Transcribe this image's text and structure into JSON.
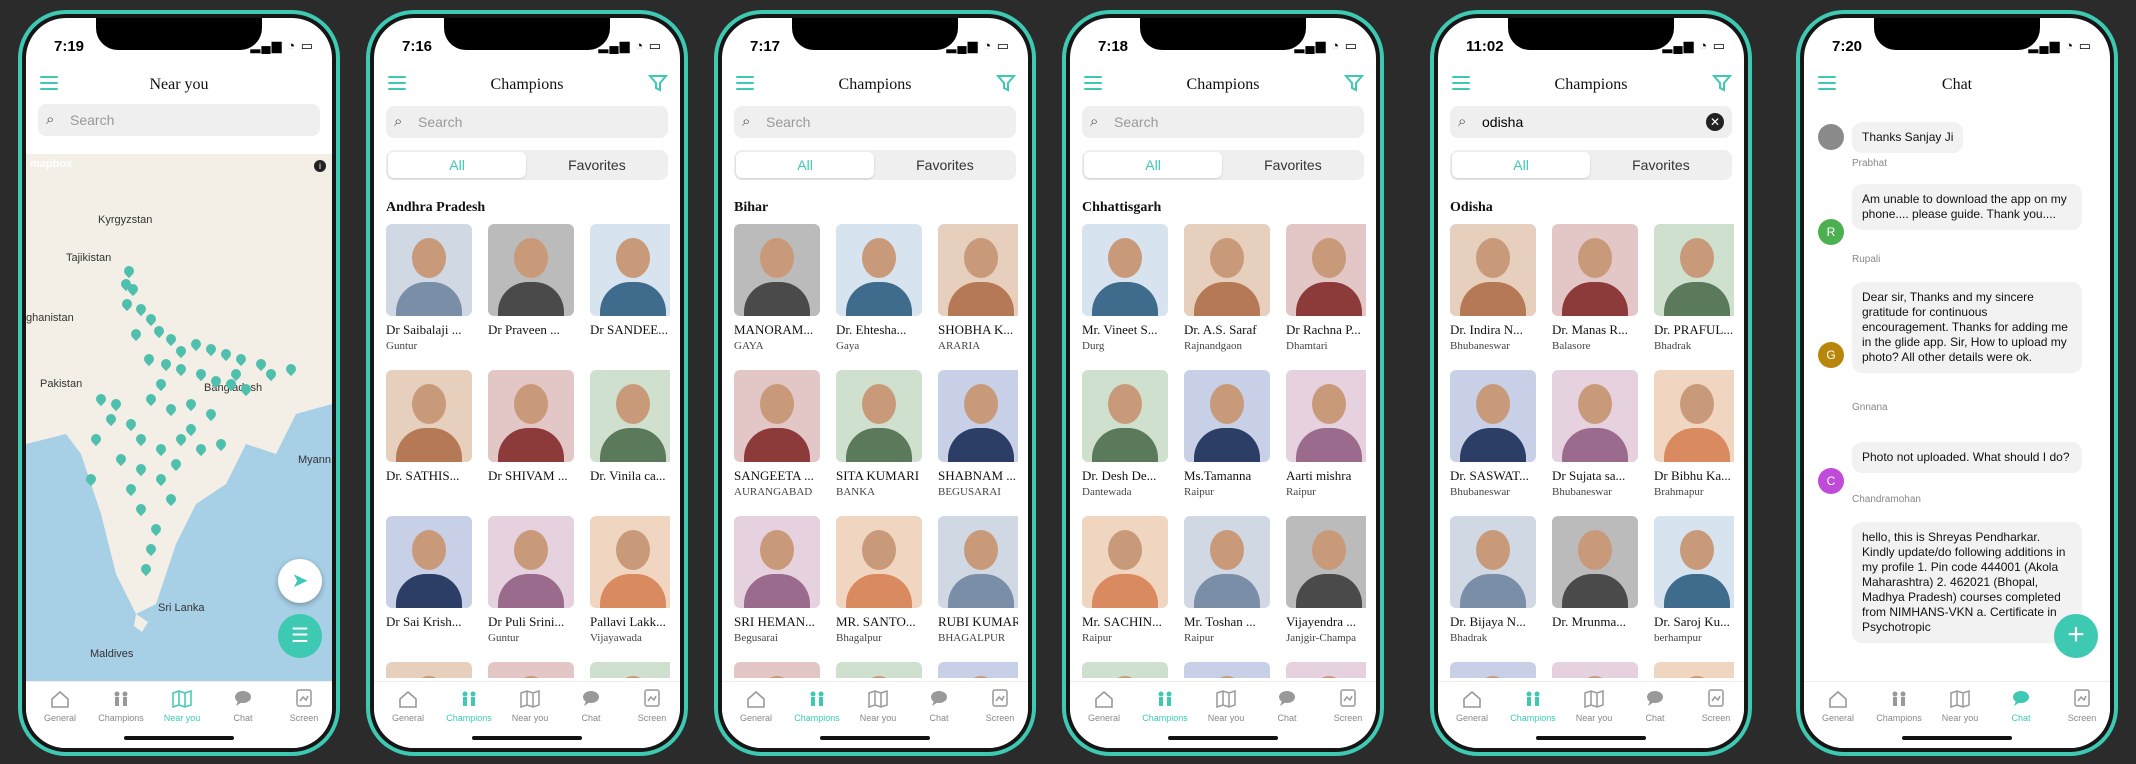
{
  "colors": {
    "accent": "#3ec9b3",
    "frame": "#161616",
    "map_water": "#a7cfe6",
    "map_land": "#f3efe6"
  },
  "tabs": [
    "General",
    "Champions",
    "Near you",
    "Chat",
    "Screen"
  ],
  "screens": [
    {
      "id": "near",
      "time": "7:19",
      "title": "Near you",
      "search_placeholder": "Search",
      "map": {
        "brand": "mapbox",
        "labels": [
          "Kyrgyzstan",
          "Tajikistan",
          "ghanistan",
          "Pakistan",
          "Nepal",
          "Bangladesh",
          "Myann (Burn",
          "Sri Lanka",
          "Maldives"
        ]
      },
      "active_tab": "Near you"
    },
    {
      "id": "ap",
      "time": "7:16",
      "title": "Champions",
      "search_placeholder": "Search",
      "seg": [
        "All",
        "Favorites"
      ],
      "section": "Andhra Pradesh",
      "cards": [
        {
          "name": "Dr Saibalaji ...",
          "city": "Guntur"
        },
        {
          "name": "Dr Praveen ...",
          "city": ""
        },
        {
          "name": "Dr SANDEE...",
          "city": ""
        },
        {
          "name": "Dr. SATHIS...",
          "city": ""
        },
        {
          "name": "Dr SHIVAM ...",
          "city": ""
        },
        {
          "name": "Dr. Vinila ca...",
          "city": ""
        },
        {
          "name": "Dr Sai Krish...",
          "city": ""
        },
        {
          "name": "Dr Puli Srini...",
          "city": "Guntur"
        },
        {
          "name": "Pallavi Lakk...",
          "city": "Vijayawada"
        }
      ],
      "active_tab": "Champions"
    },
    {
      "id": "bihar",
      "time": "7:17",
      "title": "Champions",
      "search_placeholder": "Search",
      "seg": [
        "All",
        "Favorites"
      ],
      "section": "Bihar",
      "cards": [
        {
          "name": "MANORAM...",
          "city": "GAYA"
        },
        {
          "name": "Dr. Ehtesha...",
          "city": "Gaya"
        },
        {
          "name": "SHOBHA K...",
          "city": "ARARIA"
        },
        {
          "name": "SANGEETA ...",
          "city": "AURANGABAD"
        },
        {
          "name": "SITA KUMARI",
          "city": "BANKA"
        },
        {
          "name": "SHABNAM ...",
          "city": "BEGUSARAI"
        },
        {
          "name": "SRI HEMAN...",
          "city": "Begusarai"
        },
        {
          "name": "MR. SANTO...",
          "city": "Bhagalpur"
        },
        {
          "name": "RUBI KUMARI",
          "city": "BHAGALPUR"
        }
      ],
      "active_tab": "Champions"
    },
    {
      "id": "chh",
      "time": "7:18",
      "title": "Champions",
      "search_placeholder": "Search",
      "seg": [
        "All",
        "Favorites"
      ],
      "section": "Chhattisgarh",
      "cards": [
        {
          "name": "Mr. Vineet S...",
          "city": "Durg"
        },
        {
          "name": "Dr. A.S. Saraf",
          "city": "Rajnandgaon"
        },
        {
          "name": "Dr Rachna P...",
          "city": "Dhamtari"
        },
        {
          "name": "Dr. Desh De...",
          "city": "Dantewada"
        },
        {
          "name": "Ms.Tamanna",
          "city": "Raipur"
        },
        {
          "name": "Aarti mishra",
          "city": "Raipur"
        },
        {
          "name": "Mr. SACHIN...",
          "city": "Raipur"
        },
        {
          "name": "Mr. Toshan ...",
          "city": "Raipur"
        },
        {
          "name": "Vijayendra ...",
          "city": "Janjgir-Champa"
        }
      ],
      "active_tab": "Champions"
    },
    {
      "id": "odisha",
      "time": "11:02",
      "title": "Champions",
      "search_value": "odisha",
      "seg": [
        "All",
        "Favorites"
      ],
      "section": "Odisha",
      "cards": [
        {
          "name": "Dr. Indira N...",
          "city": "Bhubaneswar"
        },
        {
          "name": "Dr. Manas R...",
          "city": "Balasore"
        },
        {
          "name": "Dr. PRAFUL...",
          "city": "Bhadrak"
        },
        {
          "name": "Dr. SASWAT...",
          "city": "Bhubaneswar"
        },
        {
          "name": "Dr Sujata sa...",
          "city": "Bhubaneswar"
        },
        {
          "name": "Dr Bibhu Ka...",
          "city": "Brahmapur"
        },
        {
          "name": "Dr. Bijaya N...",
          "city": "Bhadrak"
        },
        {
          "name": "Dr. Mrunma...",
          "city": ""
        },
        {
          "name": "Dr. Saroj Ku...",
          "city": "berhampur"
        }
      ],
      "active_tab": "Champions"
    },
    {
      "id": "chat",
      "time": "7:20",
      "title": "Chat",
      "active_tab": "Chat",
      "messages": [
        {
          "text": "Thanks Sanjay Ji",
          "author": "Prabhat",
          "avatar": "",
          "avatar_color": "#8a8a8a"
        },
        {
          "text": "Am unable to download the app on my phone.... please guide. Thank you....",
          "author": "Rupali",
          "avatar": "R",
          "avatar_color": "#4caf50"
        },
        {
          "text": "Dear sir, Thanks and my sincere gratitude for continuous encouragement. Thanks for adding me in the glide app. Sir, How to upload my photo? All other details were ok.",
          "author": "Gnnana",
          "avatar": "G",
          "avatar_color": "#b8860b"
        },
        {
          "text": "Photo not uploaded. What should I do?",
          "author": "Chandramohan",
          "avatar": "C",
          "avatar_color": "#c04bd8"
        },
        {
          "text": "hello, this is Shreyas Pendharkar. Kindly update/do following additions in my profile 1. Pin code 444001 (Akola Maharashtra) 2. 462021 (Bhopal, Madhya Pradesh) courses completed from NIMHANS-VKN a. Certificate in Psychotropic",
          "author": "",
          "avatar": "",
          "avatar_color": ""
        }
      ]
    }
  ]
}
